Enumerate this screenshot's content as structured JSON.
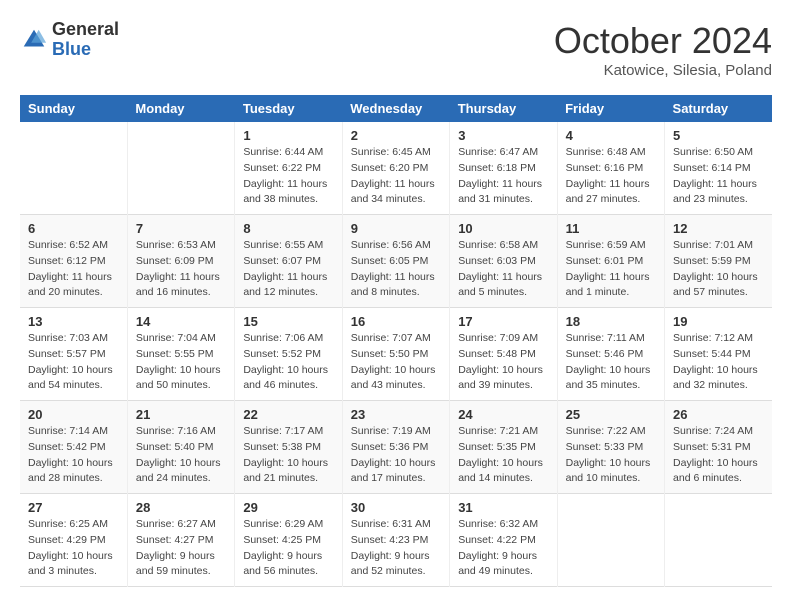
{
  "header": {
    "logo_general": "General",
    "logo_blue": "Blue",
    "month_title": "October 2024",
    "subtitle": "Katowice, Silesia, Poland"
  },
  "weekdays": [
    "Sunday",
    "Monday",
    "Tuesday",
    "Wednesday",
    "Thursday",
    "Friday",
    "Saturday"
  ],
  "weeks": [
    [
      {
        "day": "",
        "sunrise": "",
        "sunset": "",
        "daylight": ""
      },
      {
        "day": "",
        "sunrise": "",
        "sunset": "",
        "daylight": ""
      },
      {
        "day": "1",
        "sunrise": "Sunrise: 6:44 AM",
        "sunset": "Sunset: 6:22 PM",
        "daylight": "Daylight: 11 hours and 38 minutes."
      },
      {
        "day": "2",
        "sunrise": "Sunrise: 6:45 AM",
        "sunset": "Sunset: 6:20 PM",
        "daylight": "Daylight: 11 hours and 34 minutes."
      },
      {
        "day": "3",
        "sunrise": "Sunrise: 6:47 AM",
        "sunset": "Sunset: 6:18 PM",
        "daylight": "Daylight: 11 hours and 31 minutes."
      },
      {
        "day": "4",
        "sunrise": "Sunrise: 6:48 AM",
        "sunset": "Sunset: 6:16 PM",
        "daylight": "Daylight: 11 hours and 27 minutes."
      },
      {
        "day": "5",
        "sunrise": "Sunrise: 6:50 AM",
        "sunset": "Sunset: 6:14 PM",
        "daylight": "Daylight: 11 hours and 23 minutes."
      }
    ],
    [
      {
        "day": "6",
        "sunrise": "Sunrise: 6:52 AM",
        "sunset": "Sunset: 6:12 PM",
        "daylight": "Daylight: 11 hours and 20 minutes."
      },
      {
        "day": "7",
        "sunrise": "Sunrise: 6:53 AM",
        "sunset": "Sunset: 6:09 PM",
        "daylight": "Daylight: 11 hours and 16 minutes."
      },
      {
        "day": "8",
        "sunrise": "Sunrise: 6:55 AM",
        "sunset": "Sunset: 6:07 PM",
        "daylight": "Daylight: 11 hours and 12 minutes."
      },
      {
        "day": "9",
        "sunrise": "Sunrise: 6:56 AM",
        "sunset": "Sunset: 6:05 PM",
        "daylight": "Daylight: 11 hours and 8 minutes."
      },
      {
        "day": "10",
        "sunrise": "Sunrise: 6:58 AM",
        "sunset": "Sunset: 6:03 PM",
        "daylight": "Daylight: 11 hours and 5 minutes."
      },
      {
        "day": "11",
        "sunrise": "Sunrise: 6:59 AM",
        "sunset": "Sunset: 6:01 PM",
        "daylight": "Daylight: 11 hours and 1 minute."
      },
      {
        "day": "12",
        "sunrise": "Sunrise: 7:01 AM",
        "sunset": "Sunset: 5:59 PM",
        "daylight": "Daylight: 10 hours and 57 minutes."
      }
    ],
    [
      {
        "day": "13",
        "sunrise": "Sunrise: 7:03 AM",
        "sunset": "Sunset: 5:57 PM",
        "daylight": "Daylight: 10 hours and 54 minutes."
      },
      {
        "day": "14",
        "sunrise": "Sunrise: 7:04 AM",
        "sunset": "Sunset: 5:55 PM",
        "daylight": "Daylight: 10 hours and 50 minutes."
      },
      {
        "day": "15",
        "sunrise": "Sunrise: 7:06 AM",
        "sunset": "Sunset: 5:52 PM",
        "daylight": "Daylight: 10 hours and 46 minutes."
      },
      {
        "day": "16",
        "sunrise": "Sunrise: 7:07 AM",
        "sunset": "Sunset: 5:50 PM",
        "daylight": "Daylight: 10 hours and 43 minutes."
      },
      {
        "day": "17",
        "sunrise": "Sunrise: 7:09 AM",
        "sunset": "Sunset: 5:48 PM",
        "daylight": "Daylight: 10 hours and 39 minutes."
      },
      {
        "day": "18",
        "sunrise": "Sunrise: 7:11 AM",
        "sunset": "Sunset: 5:46 PM",
        "daylight": "Daylight: 10 hours and 35 minutes."
      },
      {
        "day": "19",
        "sunrise": "Sunrise: 7:12 AM",
        "sunset": "Sunset: 5:44 PM",
        "daylight": "Daylight: 10 hours and 32 minutes."
      }
    ],
    [
      {
        "day": "20",
        "sunrise": "Sunrise: 7:14 AM",
        "sunset": "Sunset: 5:42 PM",
        "daylight": "Daylight: 10 hours and 28 minutes."
      },
      {
        "day": "21",
        "sunrise": "Sunrise: 7:16 AM",
        "sunset": "Sunset: 5:40 PM",
        "daylight": "Daylight: 10 hours and 24 minutes."
      },
      {
        "day": "22",
        "sunrise": "Sunrise: 7:17 AM",
        "sunset": "Sunset: 5:38 PM",
        "daylight": "Daylight: 10 hours and 21 minutes."
      },
      {
        "day": "23",
        "sunrise": "Sunrise: 7:19 AM",
        "sunset": "Sunset: 5:36 PM",
        "daylight": "Daylight: 10 hours and 17 minutes."
      },
      {
        "day": "24",
        "sunrise": "Sunrise: 7:21 AM",
        "sunset": "Sunset: 5:35 PM",
        "daylight": "Daylight: 10 hours and 14 minutes."
      },
      {
        "day": "25",
        "sunrise": "Sunrise: 7:22 AM",
        "sunset": "Sunset: 5:33 PM",
        "daylight": "Daylight: 10 hours and 10 minutes."
      },
      {
        "day": "26",
        "sunrise": "Sunrise: 7:24 AM",
        "sunset": "Sunset: 5:31 PM",
        "daylight": "Daylight: 10 hours and 6 minutes."
      }
    ],
    [
      {
        "day": "27",
        "sunrise": "Sunrise: 6:25 AM",
        "sunset": "Sunset: 4:29 PM",
        "daylight": "Daylight: 10 hours and 3 minutes."
      },
      {
        "day": "28",
        "sunrise": "Sunrise: 6:27 AM",
        "sunset": "Sunset: 4:27 PM",
        "daylight": "Daylight: 9 hours and 59 minutes."
      },
      {
        "day": "29",
        "sunrise": "Sunrise: 6:29 AM",
        "sunset": "Sunset: 4:25 PM",
        "daylight": "Daylight: 9 hours and 56 minutes."
      },
      {
        "day": "30",
        "sunrise": "Sunrise: 6:31 AM",
        "sunset": "Sunset: 4:23 PM",
        "daylight": "Daylight: 9 hours and 52 minutes."
      },
      {
        "day": "31",
        "sunrise": "Sunrise: 6:32 AM",
        "sunset": "Sunset: 4:22 PM",
        "daylight": "Daylight: 9 hours and 49 minutes."
      },
      {
        "day": "",
        "sunrise": "",
        "sunset": "",
        "daylight": ""
      },
      {
        "day": "",
        "sunrise": "",
        "sunset": "",
        "daylight": ""
      }
    ]
  ]
}
